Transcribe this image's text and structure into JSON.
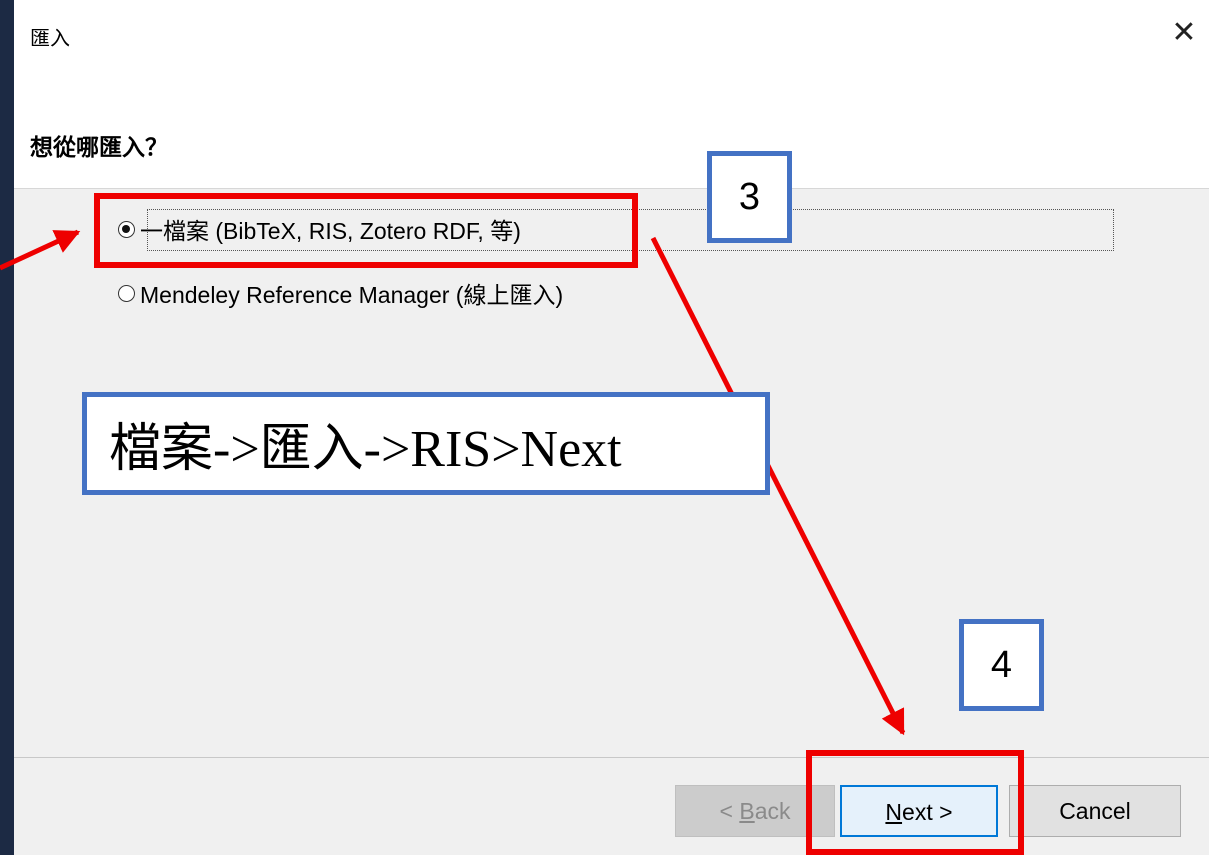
{
  "dialog": {
    "title": "匯入",
    "close_glyph": "✕",
    "heading": "想從哪匯入？",
    "options": [
      {
        "label": "一檔案 (BibTeX, RIS, Zotero RDF, 等)",
        "checked": true
      },
      {
        "label": "Mendeley Reference Manager (線上匯入)",
        "checked": false
      }
    ],
    "buttons": {
      "back": {
        "prefix": "< ",
        "mnemonic": "B",
        "rest": "ack",
        "enabled": false
      },
      "next": {
        "mnemonic": "N",
        "rest": "ext >",
        "enabled": true
      },
      "cancel": {
        "label": "Cancel",
        "enabled": true
      }
    }
  },
  "annotations": {
    "step3": "3",
    "step4": "4",
    "caption": "檔案->匯入->RIS>Next",
    "highlight_color": "#ee0000",
    "callout_border_color": "#4472c4"
  }
}
